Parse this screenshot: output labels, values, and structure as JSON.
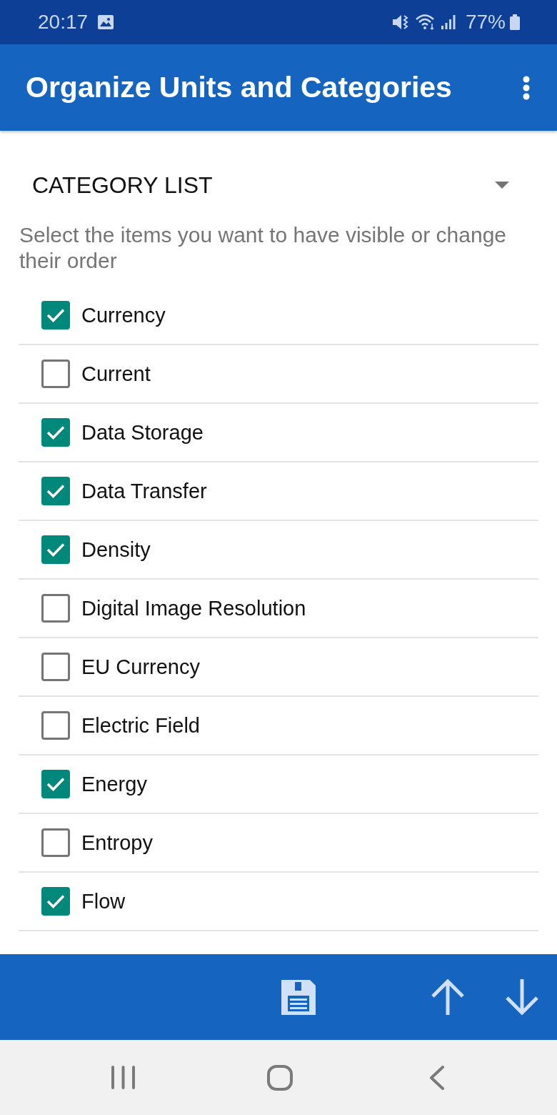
{
  "status_bar": {
    "time": "20:17",
    "battery_text": "77%"
  },
  "app_bar": {
    "title": "Organize Units and Categories"
  },
  "category_list": {
    "title": "CATEGORY LIST",
    "description": "Select the items you want to have visible or change their order",
    "items": [
      {
        "label": "Currency",
        "checked": true
      },
      {
        "label": "Current",
        "checked": false
      },
      {
        "label": "Data Storage",
        "checked": true
      },
      {
        "label": "Data Transfer",
        "checked": true
      },
      {
        "label": "Density",
        "checked": true
      },
      {
        "label": "Digital Image Resolution",
        "checked": false
      },
      {
        "label": "EU Currency",
        "checked": false
      },
      {
        "label": "Electric Field",
        "checked": false
      },
      {
        "label": "Energy",
        "checked": true
      },
      {
        "label": "Entropy",
        "checked": false
      },
      {
        "label": "Flow",
        "checked": true
      }
    ]
  }
}
